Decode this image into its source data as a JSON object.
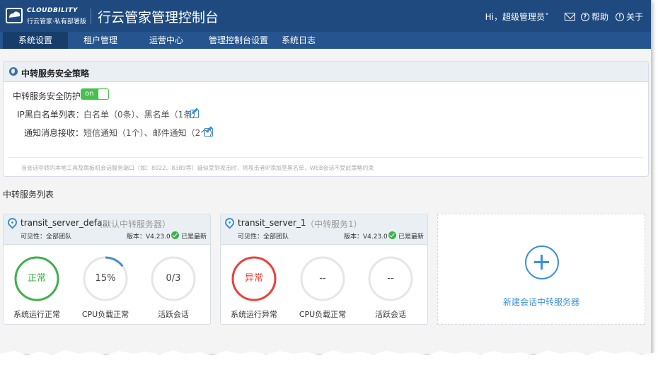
{
  "header": {
    "logo_name": "CLOUDBILITY",
    "logo_tagline": "行云管家·私有部署版",
    "title": "行云管家管理控制台",
    "user": "Hi，超级管理员",
    "help_label": "帮助",
    "about_label": "关于",
    "brand_color": "#1e4a7f"
  },
  "nav": {
    "items": [
      "系统设置",
      "租户管理",
      "运营中心",
      "管理控制台设置",
      "系统日志"
    ],
    "active": "系统设置"
  },
  "security": {
    "title": "中转服务安全策略",
    "protect_label": "中转服务安全防护：",
    "toggle_text": "on",
    "toggle_on": true,
    "ip_list_label": "IP黑白名单列表：",
    "ip_list_value": "白名单（0条）、黑名单（1条）",
    "notify_label": "通知消息接收：",
    "notify_value": "短信通知（1个）、邮件通知（2个）",
    "note": "当会话中转的本地工具及跳板机会话服务端口（如：8022、8389等）疑似受到攻击时，将攻击者IP添加至黑名单，WEB会话不受此策略约束"
  },
  "servers_section_title": "中转服务列表",
  "servers": [
    {
      "name": "transit_server_defa...",
      "subtitle": "（默认中转服务器）",
      "visibility": "可见性：全部团队",
      "version": "版本：V4.23.0",
      "latest": "已是最新",
      "status_value": "正常",
      "status_caption": "系统运行正常",
      "status_color": "#3fb04a",
      "cpu_value": "15%",
      "cpu_fraction": 0.15,
      "cpu_caption": "CPU负载正常",
      "sessions_value": "0/3",
      "sessions_caption": "活跃会话"
    },
    {
      "name": "transit_server_1",
      "subtitle": "（中转服务1）",
      "visibility": "可见性：全部团队",
      "version": "版本：V4.23.0",
      "latest": "已是最新",
      "status_value": "异常",
      "status_caption": "系统运行异常",
      "status_color": "#e8423a",
      "cpu_value": "--",
      "cpu_fraction": 0,
      "cpu_caption": "CPU负载正常",
      "sessions_value": "--",
      "sessions_caption": "活跃会话"
    }
  ],
  "add_server_label": "新建会话中转服务器"
}
